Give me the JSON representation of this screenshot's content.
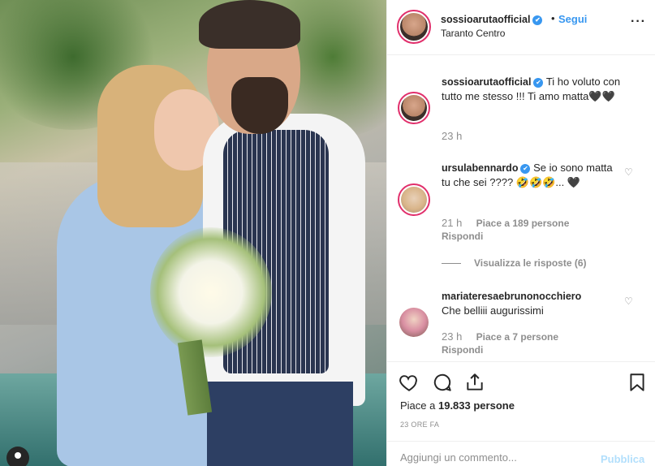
{
  "post": {
    "author": "sossioarutaofficial",
    "verified_mark": "✔",
    "dot": "•",
    "follow_label": "Segui",
    "location": "Taranto Centro",
    "more_label": "···"
  },
  "comments": [
    {
      "username": "sossioarutaofficial",
      "text": "Ti ho voluto con tutto me stesso !!! Ti amo matta🖤🖤",
      "time": "23 h"
    },
    {
      "username": "ursulabennardo",
      "text": "Se io sono matta tu che sei ???? 🤣🤣🤣... 🖤",
      "time": "21 h",
      "likes": "Piace a 189 persone",
      "reply_label": "Rispondi",
      "view_replies": "Visualizza le risposte (6)"
    },
    {
      "username": "mariateresaebrunonocchiero",
      "text": "Che belliii augurissimi",
      "time": "23 h",
      "likes": "Piace a 7 persone",
      "reply_label": "Rispondi"
    }
  ],
  "actions": {
    "likes_prefix": "Piace a ",
    "likes_count": "19.833 persone",
    "time_ago": "23 ORE FA",
    "comment_placeholder": "Aggiungi un commento...",
    "post_label": "Pubblica"
  },
  "icons": [
    "heart-icon",
    "comment-icon",
    "share-icon",
    "bookmark-icon",
    "tag-user-icon"
  ],
  "colors": {
    "link": "#3897f0",
    "verified": "#3897f0",
    "muted": "#8e8e8e",
    "text": "#262626",
    "post_disabled": "#b2dffc"
  }
}
